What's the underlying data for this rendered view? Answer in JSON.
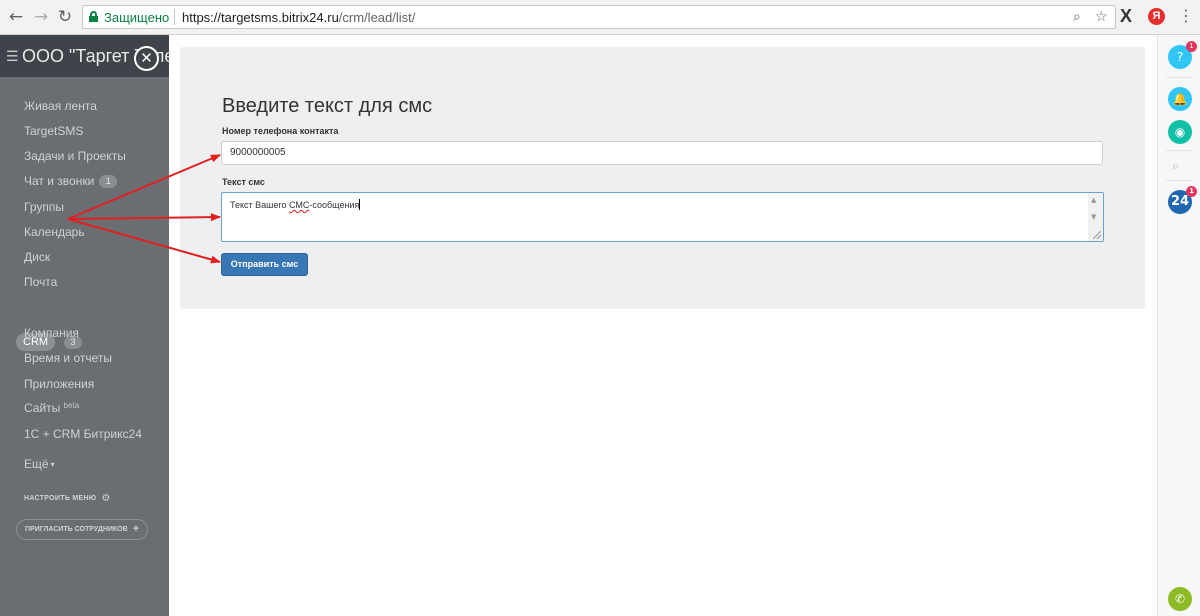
{
  "browser": {
    "back_icon": "arrow-left-icon",
    "forward_icon": "arrow-right-icon",
    "reload_icon": "reload-icon",
    "secure_label": "Защищено",
    "url_protocol": "https://",
    "url_host": "targetsms.bitrix24.ru",
    "url_path": "/crm/lead/list/",
    "zoom_icon": "zoom-icon",
    "bookmark_icon": "star-icon",
    "ext_x": "X",
    "ext_ya": "Я",
    "menu_icon": "more-vert-icon"
  },
  "sidebar": {
    "title": "ООО \"Таргет Теле",
    "close_glyph": "✕",
    "items": [
      {
        "label": "Живая лента"
      },
      {
        "label": "TargetSMS"
      },
      {
        "label": "Задачи и Проекты"
      },
      {
        "label": "Чат и звонки",
        "count": "1"
      },
      {
        "label": "Группы"
      },
      {
        "label": "Календарь"
      },
      {
        "label": "Диск"
      },
      {
        "label": "Почта"
      },
      {
        "label": "CRM",
        "count": "3"
      },
      {
        "label": "Компания"
      },
      {
        "label": "Время и отчеты"
      },
      {
        "label": "Приложения"
      },
      {
        "label": "Сайты",
        "sup": "beta"
      },
      {
        "label": "1С + CRM Битрикс24"
      },
      {
        "label": "Ещё"
      }
    ],
    "settings_label": "НАСТРОИТЬ МЕНЮ",
    "invite_label": "ПРИГЛАСИТЬ СОТРУДНИКОВ"
  },
  "form": {
    "title": "Введите текст для смс",
    "phone_label": "Номер телефона контакта",
    "phone_value": "9000000005",
    "sms_label": "Текст смс",
    "sms_text_before": "Текст Вашего ",
    "sms_text_typo": "СМС",
    "sms_text_after": "-сообщения",
    "send_button": "Отправить смс"
  },
  "right_panel": {
    "help_badge": "1",
    "b24_label": "24",
    "b24_badge": "1",
    "colors": {
      "help": "#2fc6f6",
      "bell": "#2fc6f6",
      "chat": "#12c0a8",
      "b24": "#2067b0",
      "phone": "#8dbb25"
    }
  },
  "annotation": {
    "arrow_color": "#e02020"
  }
}
